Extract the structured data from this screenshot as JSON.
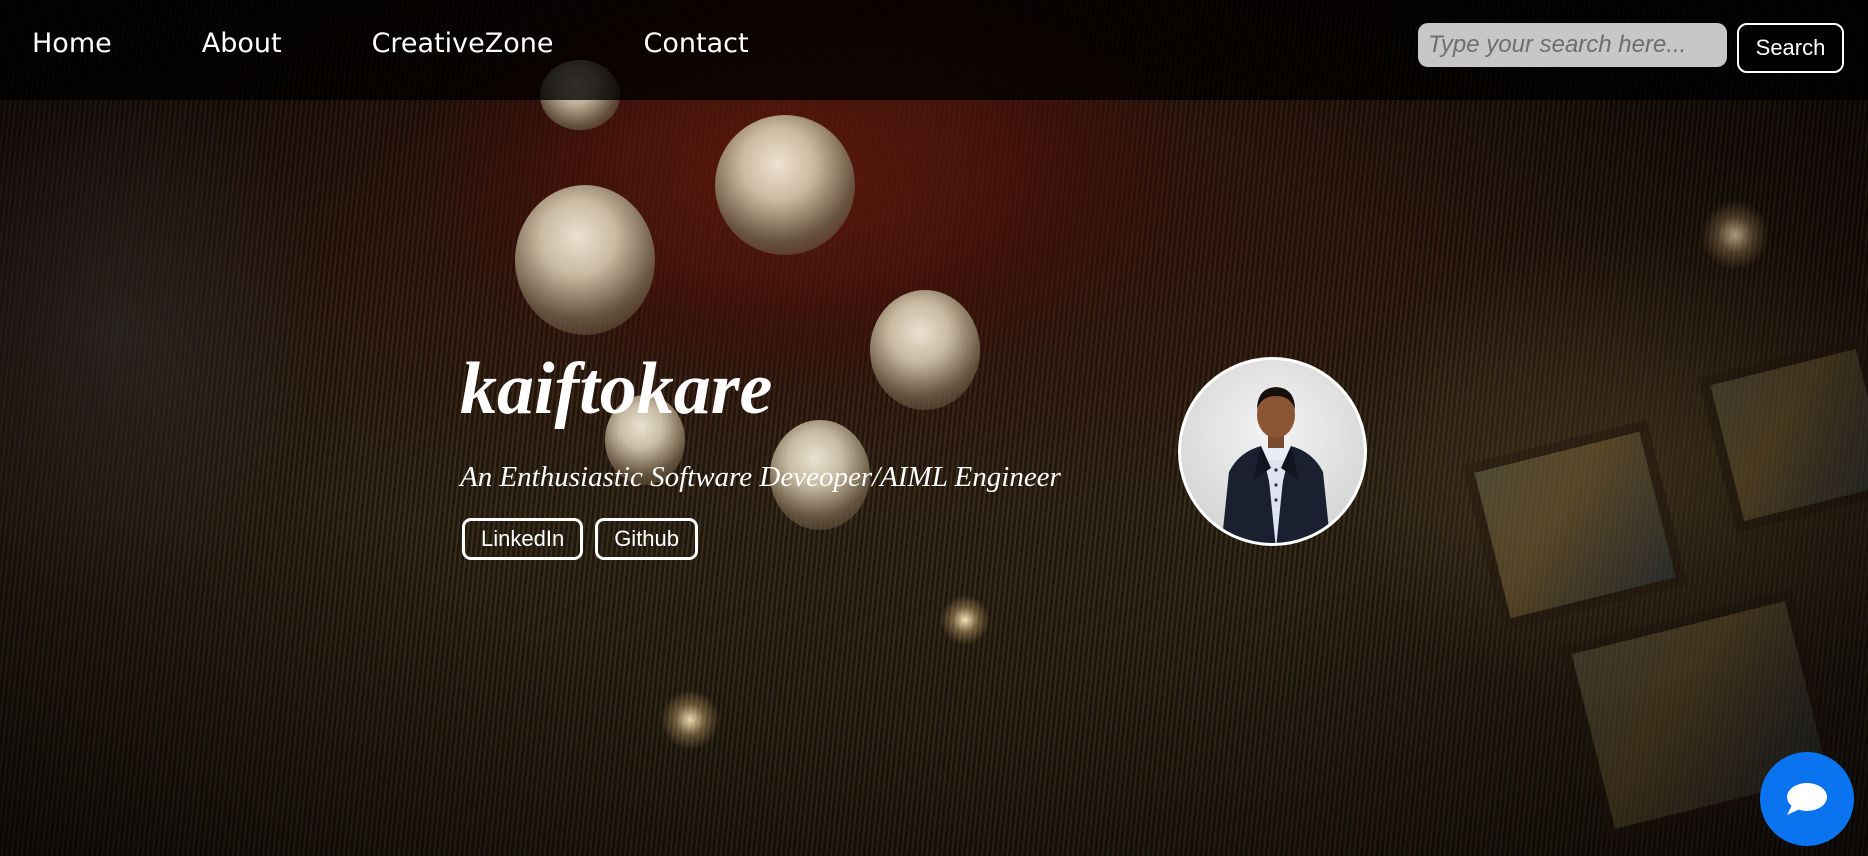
{
  "nav": {
    "items": [
      {
        "label": "Home"
      },
      {
        "label": "About"
      },
      {
        "label": "CreativeZone"
      },
      {
        "label": "Contact"
      }
    ]
  },
  "search": {
    "placeholder": "Type your search here...",
    "value": "",
    "button_label": "Search"
  },
  "hero": {
    "name": "kaiftokare",
    "tagline": "An Enthusiastic Software Deveoper/AIML Engineer",
    "links": [
      {
        "label": "LinkedIn"
      },
      {
        "label": "Github"
      }
    ],
    "avatar_icon": "profile-photo"
  },
  "chat": {
    "icon": "chat-bubble-icon",
    "color": "#0a74f0"
  },
  "colors": {
    "text": "#ffffff",
    "header_bg": "#000000",
    "search_bg": "#c8c6c6"
  }
}
